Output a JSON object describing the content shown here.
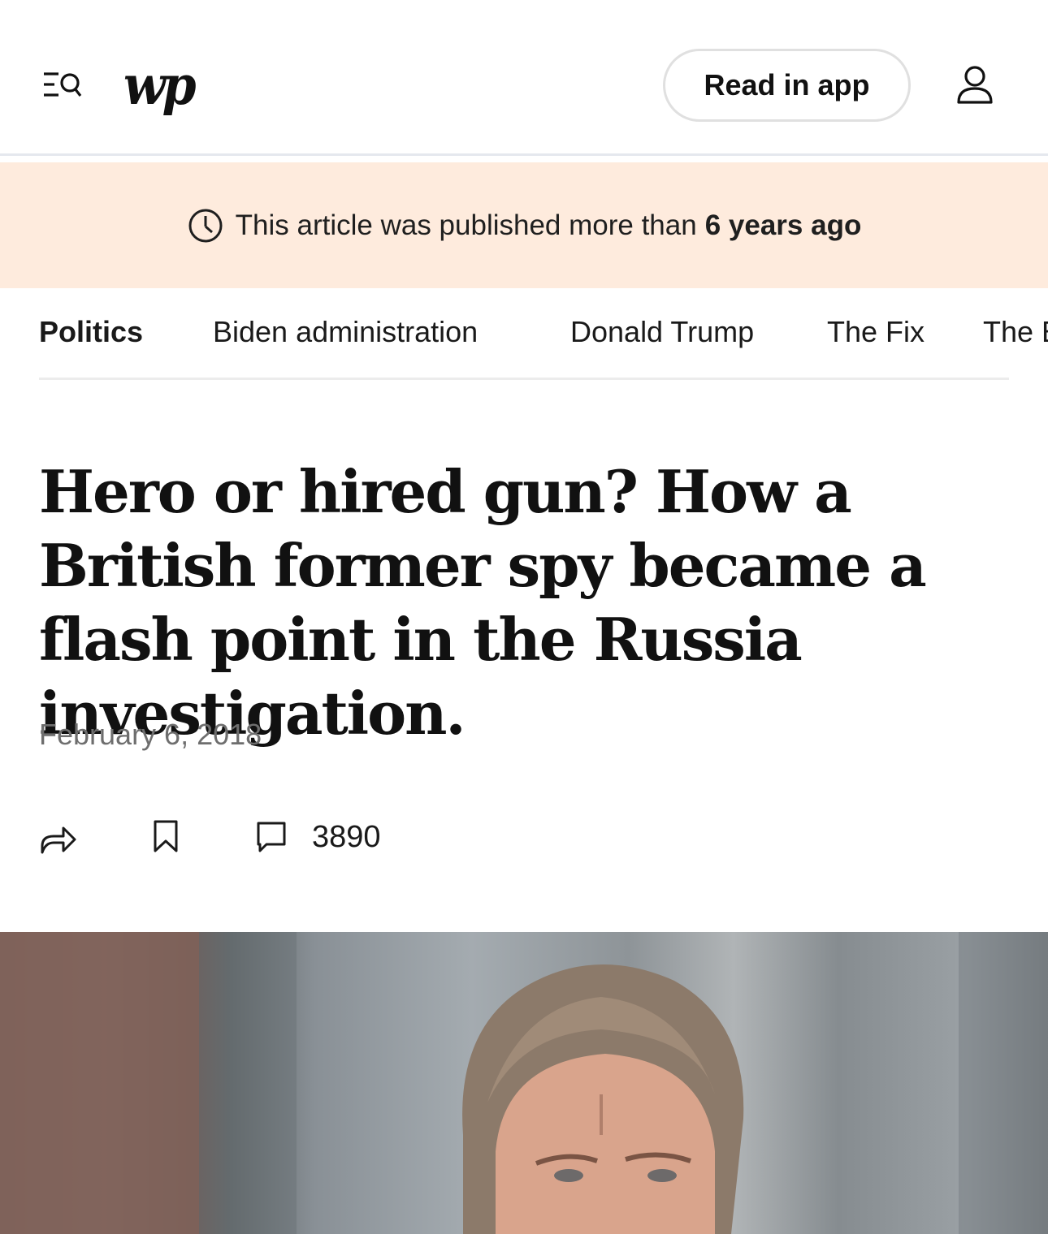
{
  "header": {
    "logo_text": "wp",
    "read_in_app_label": "Read in app",
    "menu_icon": "menu-search-icon",
    "account_icon": "account-icon"
  },
  "banner": {
    "prefix": "This article was published more than",
    "emphasis": "6 years ago",
    "icon": "clock-icon",
    "background": "#feebdd"
  },
  "nav": {
    "items": [
      {
        "label": "Politics",
        "active": true
      },
      {
        "label": "Biden administration",
        "active": false
      },
      {
        "label": "Donald Trump",
        "active": false
      },
      {
        "label": "The Fix",
        "active": false
      },
      {
        "label": "The E",
        "active": false
      }
    ]
  },
  "article": {
    "headline": "Hero or hired gun? How a British former spy became a flash point in the Russia investigation.",
    "date": "February 6, 2018",
    "comment_count": "3890",
    "actions": [
      "share-icon",
      "bookmark-icon",
      "comment-icon"
    ]
  }
}
